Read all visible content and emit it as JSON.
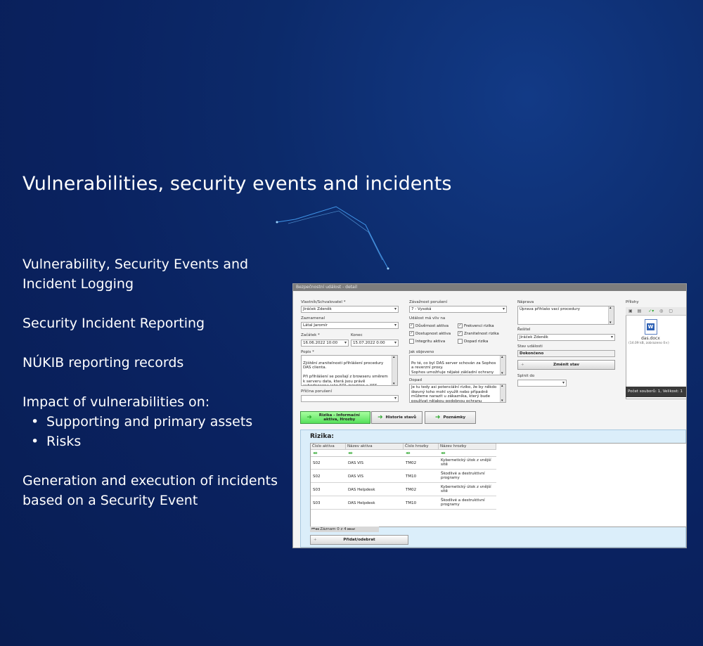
{
  "slide": {
    "title": "Vulnerabilities, security events and incidents",
    "paragraphs": [
      "Vulnerability, Security Events and Incident Logging",
      "Security Incident Reporting",
      "NÚKIB reporting records",
      "Impact of vulnerabilities on:"
    ],
    "bullets": [
      "Supporting and primary assets",
      "Risks"
    ],
    "closing": "Generation and execution of incidents based on a Security Event"
  },
  "app": {
    "window_title": "Bezpečnostní událost - detail",
    "owner_label": "Vlastník/Schvalovatel *",
    "owner_value": "Jiráček Zdeněk",
    "recorded_label": "Zaznamenal",
    "recorded_value": "Látal Jaromír",
    "start_label": "Začátek *",
    "start_value": "16.06.2022 10:00",
    "end_label": "Konec",
    "end_value": "15.07.2022 0:00",
    "desc_label": "Popis *",
    "desc_text": "Zjištění zranitelnosti přihlášení procedury DAS clienta.\n\nPři přihlášení se posílají z browseru směrem k serveru data, která jsou právě vyhodnocena jako SQL injection a XSS attacks - nutné",
    "cause_label": "Příčina porušení",
    "severity_label": "Závažnost porušení",
    "severity_value": "7 - Vysoká",
    "impact_label": "Událost má vliv na",
    "checks": [
      {
        "label": "Důvěrnost aktiva",
        "checked": true
      },
      {
        "label": "Frekvenci rizika",
        "checked": true
      },
      {
        "label": "Dostupnost aktiva",
        "checked": true
      },
      {
        "label": "Zranitelnost rizika",
        "checked": true
      },
      {
        "label": "Integritu aktiva",
        "checked": false
      },
      {
        "label": "Dopad rizika",
        "checked": false
      }
    ],
    "detected_label": "Jak objeveno",
    "detected_text": "Po té, co byl DAS server schován za Sophos a reverzní proxy.\nSophos umožňuje nějaké základní ochrany SQL injection apod. a v případě odhalení jsou zákaz",
    "dopad_label": "Dopad",
    "dopad_text": "Je tu tedy asi potenciální riziko, že by někdo škevný toho mohl využít nebo případně můžeme narazit u zákazníka, který bude používat nějakou podobnou ochranu",
    "remedy_label": "Náprava",
    "remedy_text": "Úprava přihlašo vací procedury",
    "solver_label": "Řešitel",
    "solver_value": "Jiráček Zdeněk",
    "state_label": "Stav události",
    "state_value": "Dokončeno",
    "change_state_label": "Změnit stav",
    "fulfill_label": "Splnit do",
    "attachments_label": "Přílohy",
    "file_name": "das.docx",
    "file_meta": "(14.09 kB, zobrazeno 0×)",
    "file_count": "Počet souborů: 1, Velikost: 1",
    "tabs": [
      "Rizika - Informační aktiva, Hrozby",
      "Historie stavů",
      "Poznámky"
    ],
    "risks_title": "Rizika:",
    "columns": [
      "Číslo aktiva",
      "Název aktiva",
      "Číslo hrozby",
      "Název hrozby"
    ],
    "rows": [
      [
        "S02",
        "DAS VIS",
        "TM02",
        "Kybernetický útok z vnější sítě"
      ],
      [
        "S02",
        "DAS VIS",
        "TM10",
        "Škodlivé a destruktivní programy"
      ],
      [
        "S03",
        "DAS Helpdesk",
        "TM02",
        "Kybernetický útok z vnější sítě"
      ],
      [
        "S03",
        "DAS Helpdesk",
        "TM10",
        "Škodlivé a destruktivní programy"
      ]
    ],
    "pager": "Záznam 0 z 4",
    "add_remove_label": "Přidat/odebrat"
  }
}
